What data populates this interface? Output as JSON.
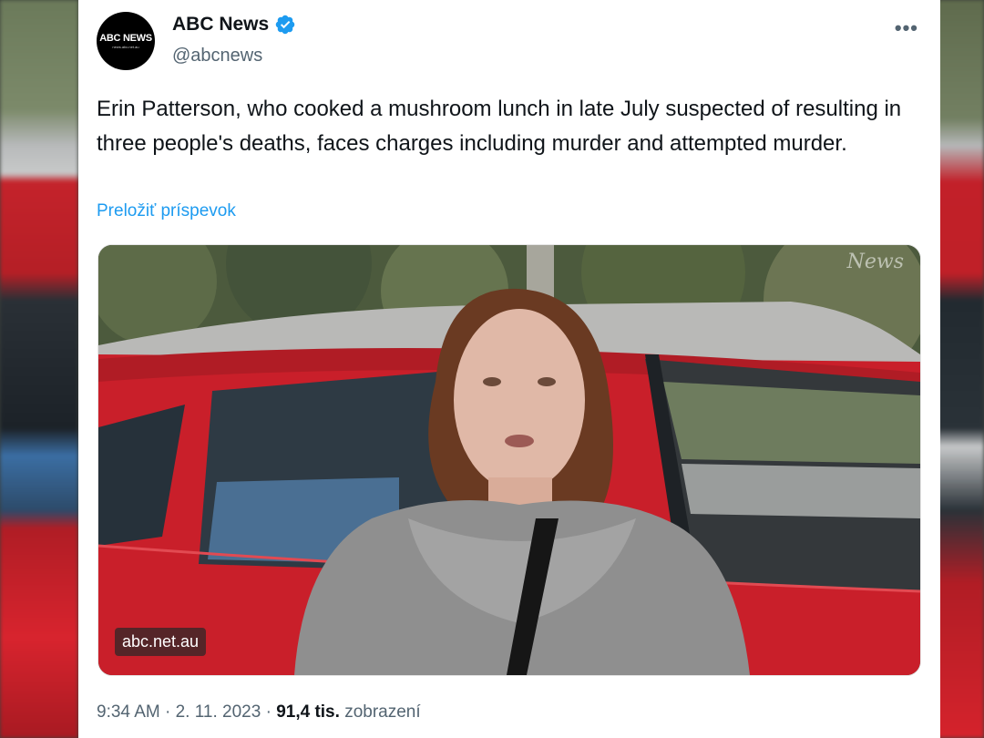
{
  "author": {
    "display_name": "ABC News",
    "handle": "@abcnews",
    "avatar_logo": "ABC NEWS",
    "avatar_sub": "news.abc.net.au",
    "verified": true
  },
  "tweet": {
    "text": "Erin Patterson, who cooked a mushroom lunch in late July suspected of resulting in three people's deaths, faces charges including murder and attempted murder.",
    "translate_label": "Preložiť príspevok"
  },
  "media": {
    "watermark": "abc.net.au",
    "brand_mark": "News"
  },
  "meta": {
    "time": "9:34 AM",
    "separator": "·",
    "date": "2. 11. 2023",
    "views": "91,4 tis.",
    "views_label": "zobrazení"
  },
  "icons": {
    "more": "more-horizontal-icon",
    "verified": "verified-badge-icon"
  },
  "colors": {
    "accent": "#1d9bf0",
    "text_primary": "#0f1419",
    "text_secondary": "#536471"
  }
}
